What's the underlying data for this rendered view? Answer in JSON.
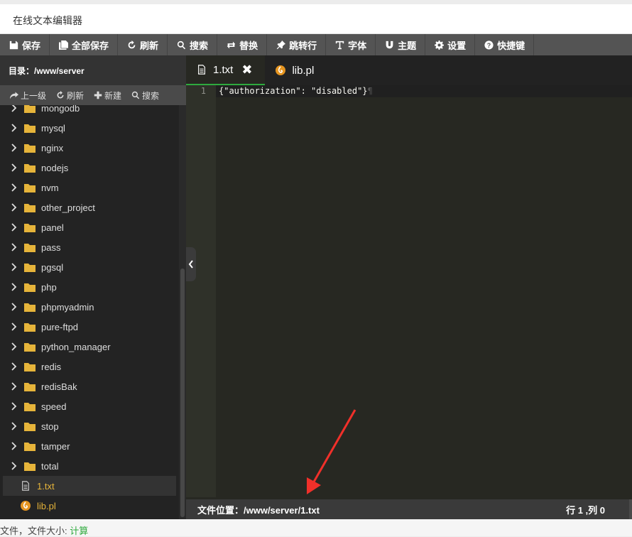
{
  "window": {
    "title": "在线文本编辑器"
  },
  "toolbar": {
    "items": [
      {
        "label": "保存",
        "icon": "save-icon"
      },
      {
        "label": "全部保存",
        "icon": "save-all-icon"
      },
      {
        "label": "刷新",
        "icon": "refresh-icon"
      },
      {
        "label": "搜索",
        "icon": "search-icon"
      },
      {
        "label": "替换",
        "icon": "replace-icon"
      },
      {
        "label": "跳转行",
        "icon": "pin-icon"
      },
      {
        "label": "字体",
        "icon": "font-icon"
      },
      {
        "label": "主题",
        "icon": "magnet-icon"
      },
      {
        "label": "设置",
        "icon": "gear-icon"
      },
      {
        "label": "快捷键",
        "icon": "help-icon"
      }
    ]
  },
  "sidebar": {
    "directory_label": "目录：/www/server",
    "actions": [
      {
        "label": "上一级",
        "icon": "share-icon"
      },
      {
        "label": "刷新",
        "icon": "refresh-icon"
      },
      {
        "label": "新建",
        "icon": "plus-icon"
      },
      {
        "label": "搜索",
        "icon": "search-icon"
      }
    ],
    "folders": [
      "mongodb",
      "mysql",
      "nginx",
      "nodejs",
      "nvm",
      "other_project",
      "panel",
      "pass",
      "pgsql",
      "php",
      "phpmyadmin",
      "pure-ftpd",
      "python_manager",
      "redis",
      "redisBak",
      "speed",
      "stop",
      "tamper",
      "total"
    ],
    "files": [
      {
        "name": "1.txt",
        "icon": "file-text-icon",
        "active": true
      },
      {
        "name": "lib.pl",
        "icon": "perl-icon",
        "active": false
      }
    ]
  },
  "editor": {
    "tabs": [
      {
        "label": "1.txt",
        "active": true,
        "close": "✖"
      },
      {
        "label": "lib.pl",
        "active": false
      }
    ],
    "line_number": "1",
    "code_line": "{\"authorization\": \"disabled\"}",
    "pilcrow": "¶"
  },
  "status": {
    "file_location": "文件位置：/www/server/1.txt",
    "cursor": "行 1 ,列 0"
  },
  "below": {
    "prefix": "文件，文件大小: ",
    "link": "计算"
  },
  "colors": {
    "accent_green": "#2eaa3e",
    "folder": "#e6b43a",
    "annotation_arrow": "#f0302a"
  }
}
